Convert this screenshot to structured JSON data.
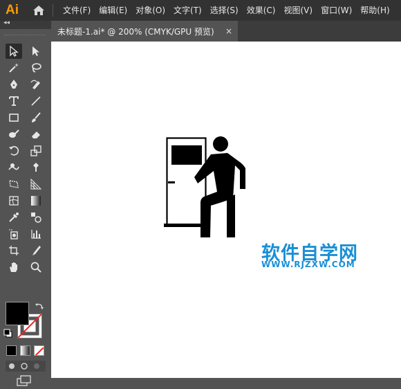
{
  "app": {
    "logo": "Ai"
  },
  "menu": [
    "文件(F)",
    "编辑(E)",
    "对象(O)",
    "文字(T)",
    "选择(S)",
    "效果(C)",
    "视图(V)",
    "窗口(W)",
    "帮助(H)"
  ],
  "tab": {
    "title": "未标题-1.ai* @ 200% (CMYK/GPU 预览)",
    "close": "×"
  },
  "toolbar": {
    "collapse": "◂◂"
  },
  "watermark": {
    "cn": "软件自学网",
    "url": "WWW.RJZXW.COM"
  },
  "colors": {
    "fill": "#000000",
    "stroke": "#ffffff",
    "accent": "#ff9a00",
    "watermark": "#1a8fd6"
  },
  "icons": [
    "home-icon",
    "selection-tool-icon",
    "direct-selection-tool-icon",
    "magic-wand-icon",
    "lasso-icon",
    "pen-tool-icon",
    "curvature-tool-icon",
    "type-tool-icon",
    "line-tool-icon",
    "rectangle-tool-icon",
    "paintbrush-icon",
    "blob-brush-icon",
    "eraser-icon",
    "rotate-tool-icon",
    "scale-tool-icon",
    "warp-tool-icon",
    "puppet-warp-icon",
    "free-transform-icon",
    "perspective-grid-icon",
    "mesh-tool-icon",
    "gradient-tool-icon",
    "eyedropper-icon",
    "blend-tool-icon",
    "symbol-sprayer-icon",
    "column-graph-icon",
    "artboard-tool-icon",
    "slice-tool-icon",
    "hand-tool-icon",
    "zoom-tool-icon"
  ]
}
